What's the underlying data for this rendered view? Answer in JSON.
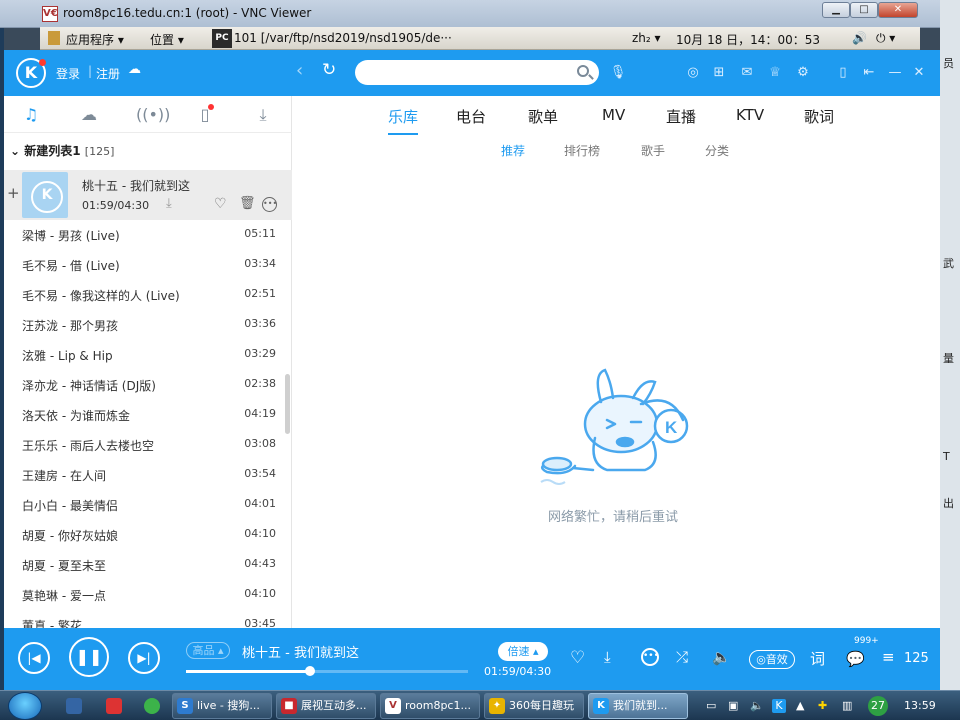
{
  "vnc": {
    "title": "room8pc16.tedu.cn:1 (root) - VNC Viewer",
    "logo": "V€"
  },
  "gnome_panel": {
    "apps_menu": "应用程序 ▾",
    "places_menu": "位置 ▾",
    "app_icon": "PC",
    "window_title": "101 [/var/ftp/nsd2019/nsd1905/de···",
    "input_method": "zh₂ ▾",
    "datetime": "10月 18 日，14：00：53",
    "volume_icon": "volume-icon",
    "power_icon": "power-icon"
  },
  "desktop_right_chars": [
    "员",
    "武",
    "量",
    "T",
    "出"
  ],
  "kugou": {
    "header": {
      "logo": "K",
      "login": "登录",
      "register": "注册",
      "search_placeholder": ""
    },
    "sidebar": {
      "tabs": [
        "music-note-icon",
        "cloud-icon",
        "radio-icon",
        "phone-icon",
        "download-icon"
      ],
      "list_title": "新建列表1",
      "list_count": "[125]",
      "now_playing": {
        "title": "桃十五 - 我们就到这",
        "time": "01:59/04:30",
        "add": "+"
      },
      "songs": [
        {
          "name": "梁博 - 男孩 (Live)",
          "duration": "05:11"
        },
        {
          "name": "毛不易 - 借 (Live)",
          "duration": "03:34"
        },
        {
          "name": "毛不易 - 像我这样的人 (Live)",
          "duration": "02:51"
        },
        {
          "name": "汪苏泷 - 那个男孩",
          "duration": "03:36"
        },
        {
          "name": "泫雅 - Lip & Hip",
          "duration": "03:29"
        },
        {
          "name": "泽亦龙 - 神话情话 (DJ版)",
          "duration": "02:38"
        },
        {
          "name": "洛天依 - 为谁而炼金",
          "duration": "04:19"
        },
        {
          "name": "王乐乐 - 雨后人去楼也空",
          "duration": "03:08"
        },
        {
          "name": "王建房 - 在人间",
          "duration": "03:54"
        },
        {
          "name": "白小白 - 最美情侣",
          "duration": "04:01"
        },
        {
          "name": "胡夏 - 你好灰姑娘",
          "duration": "04:10"
        },
        {
          "name": "胡夏 - 夏至未至",
          "duration": "04:43"
        },
        {
          "name": "莫艳琳 - 爱一点",
          "duration": "04:10"
        },
        {
          "name": "董真 - 繁花",
          "duration": "03:45"
        }
      ]
    },
    "main": {
      "tabs": [
        "乐库",
        "电台",
        "歌单",
        "MV",
        "直播",
        "KTV",
        "歌词"
      ],
      "subtabs": [
        "推荐",
        "排行榜",
        "歌手",
        "分类"
      ],
      "error_message": "网络繁忙，请稍后重试"
    },
    "player": {
      "quality": "高品 ▴",
      "track": "桃十五 - 我们就到这",
      "progress_fraction": 0.44,
      "time": "01:59/04:30",
      "speed": "倍速 ▴",
      "effect": "◎音效",
      "lyrics_btn": "词",
      "comment_badge": "999+",
      "playlist_count": "125"
    }
  },
  "taskbar": {
    "tasks": [
      {
        "label": "live - 搜狗...",
        "icon_color": "#2e7bcf",
        "icon": "S"
      },
      {
        "label": "展视互动多...",
        "icon_color": "#c8282e",
        "icon": "■"
      },
      {
        "label": "room8pc1...",
        "icon_color": "#ffffff",
        "icon": "V"
      },
      {
        "label": "360每日趣玩",
        "icon_color": "#e8b400",
        "icon": "✦"
      },
      {
        "label": "我们就到...",
        "icon_color": "#1e9bf0",
        "icon": "K"
      }
    ],
    "tray_badge": "27",
    "clock": "13:59"
  },
  "colors": {
    "kugou_blue": "#1e9bf0",
    "error_text": "#8a9aa8"
  }
}
